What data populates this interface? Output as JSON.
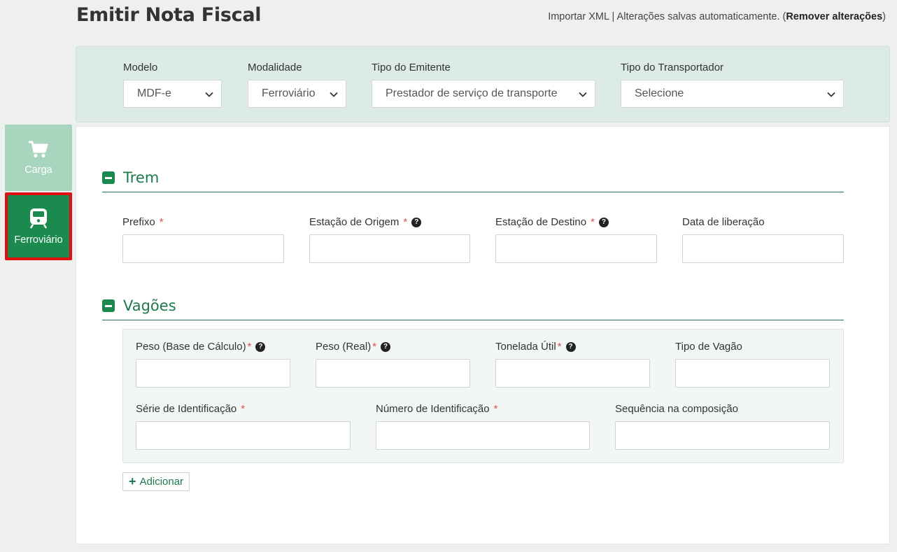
{
  "header": {
    "title": "Emitir Nota Fiscal",
    "import_xml": "Importar XML",
    "separator": "|",
    "autosave_text": "Alterações salvas automaticamente. (",
    "remove_changes": "Remover alterações",
    "close_paren": ")"
  },
  "filters": {
    "modelo": {
      "label": "Modelo",
      "value": "MDF-e"
    },
    "modalidade": {
      "label": "Modalidade",
      "value": "Ferroviário"
    },
    "tipo_emitente": {
      "label": "Tipo do Emitente",
      "value": "Prestador de serviço de transporte"
    },
    "tipo_transportador": {
      "label": "Tipo do Transportador",
      "value": "Selecione"
    }
  },
  "sidebar": {
    "items": [
      {
        "label": "Carga",
        "icon": "cart-icon"
      },
      {
        "label": "Ferroviário",
        "icon": "train-icon"
      }
    ]
  },
  "trem": {
    "title": "Trem",
    "prefixo": "Prefixo",
    "estacao_origem": "Estação de Origem",
    "estacao_destino": "Estação de Destino",
    "data_liberacao": "Data de liberação"
  },
  "vagoes": {
    "title": "Vagões",
    "peso_base": "Peso (Base de Cálculo)",
    "peso_real": "Peso (Real)",
    "tonelada_util": "Tonelada Útil",
    "tipo_vagao": "Tipo de Vagão",
    "serie_ident": "Série de Identificação",
    "numero_ident": "Número de Identificação",
    "sequencia": "Sequência na composição",
    "add_label": "Adicionar"
  },
  "required_mark": "*",
  "help_mark": "?",
  "colors": {
    "accent": "#1a8a4e",
    "panel": "#dcebe3",
    "highlight_border": "#e01010",
    "required": "#d9534f"
  }
}
